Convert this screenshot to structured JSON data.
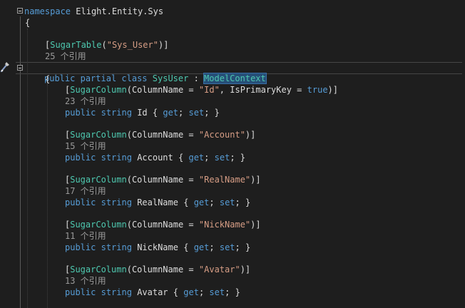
{
  "code": {
    "namespace_kw": "namespace",
    "namespace_name": "Elight.Entity.Sys",
    "open_brace": "{",
    "class_attr_open": "[",
    "class_attr_name": "SugarTable",
    "class_attr_paren_open": "(",
    "class_attr_value": "\"Sys_User\"",
    "class_attr_close": ")]",
    "class_refs": "25 个引用",
    "class_kw_public": "public",
    "class_kw_partial": "partial",
    "class_kw_class": "class",
    "class_name": "SysUser",
    "class_colon": ":",
    "base_class": "ModelContext",
    "class_open_brace": "{",
    "column_attr_name": "SugarColumn",
    "column_param": "ColumnName",
    "equals": " = ",
    "kw_public": "public",
    "kw_string": "string",
    "kw_get": "get",
    "kw_set": "set",
    "properties": [
      {
        "column": "\"Id\"",
        "extra_param": "IsPrimaryKey",
        "extra_value": "true",
        "refs": "23 个引用",
        "name": "Id"
      },
      {
        "column": "\"Account\"",
        "refs": "15 个引用",
        "name": "Account"
      },
      {
        "column": "\"RealName\"",
        "refs": "17 个引用",
        "name": "RealName"
      },
      {
        "column": "\"NickName\"",
        "refs": "11 个引用",
        "name": "NickName"
      },
      {
        "column": "\"Avatar\"",
        "refs": "13 个引用",
        "name": "Avatar"
      }
    ]
  },
  "colors": {
    "background": "#1e1e1e",
    "keyword": "#569cd6",
    "type": "#4ec9b0",
    "string": "#d69d85",
    "text": "#dcdcdc",
    "codelens": "#9a9a9a"
  }
}
